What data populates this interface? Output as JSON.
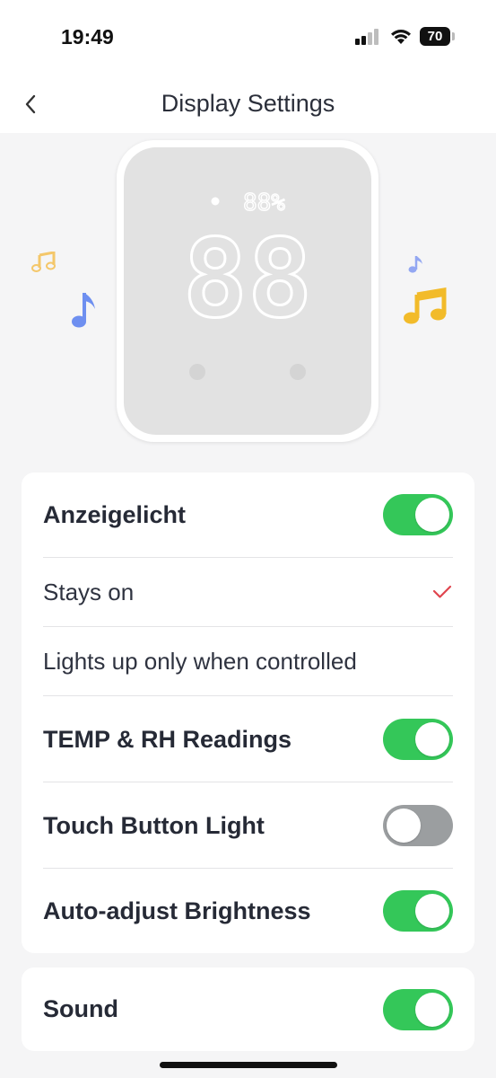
{
  "status_bar": {
    "time": "19:49",
    "battery_level": "70",
    "icons": [
      "signal-icon",
      "wifi-icon",
      "battery-icon"
    ]
  },
  "nav": {
    "title": "Display Settings",
    "back_icon": "chevron-left-icon"
  },
  "device_preview": {
    "small_readout": "88%",
    "large_readout": "88",
    "decorations": [
      "music-note-icon",
      "music-note-icon",
      "music-note-icon",
      "music-notes-icon"
    ]
  },
  "settings": {
    "indicator_light": {
      "label": "Anzeigelicht",
      "on": true
    },
    "stays_on": {
      "label": "Stays on",
      "selected": true
    },
    "lights_up_controlled": {
      "label": "Lights up only when controlled",
      "selected": false
    },
    "temp_rh": {
      "label": "TEMP & RH Readings",
      "on": true
    },
    "touch_button_light": {
      "label": "Touch Button Light",
      "on": false
    },
    "auto_brightness": {
      "label": "Auto-adjust Brightness",
      "on": true
    },
    "sound": {
      "label": "Sound",
      "on": true
    }
  },
  "colors": {
    "toggle_on": "#34c759",
    "toggle_off": "#9b9ea0",
    "checkmark": "#e0454e",
    "background": "#f5f5f6"
  }
}
